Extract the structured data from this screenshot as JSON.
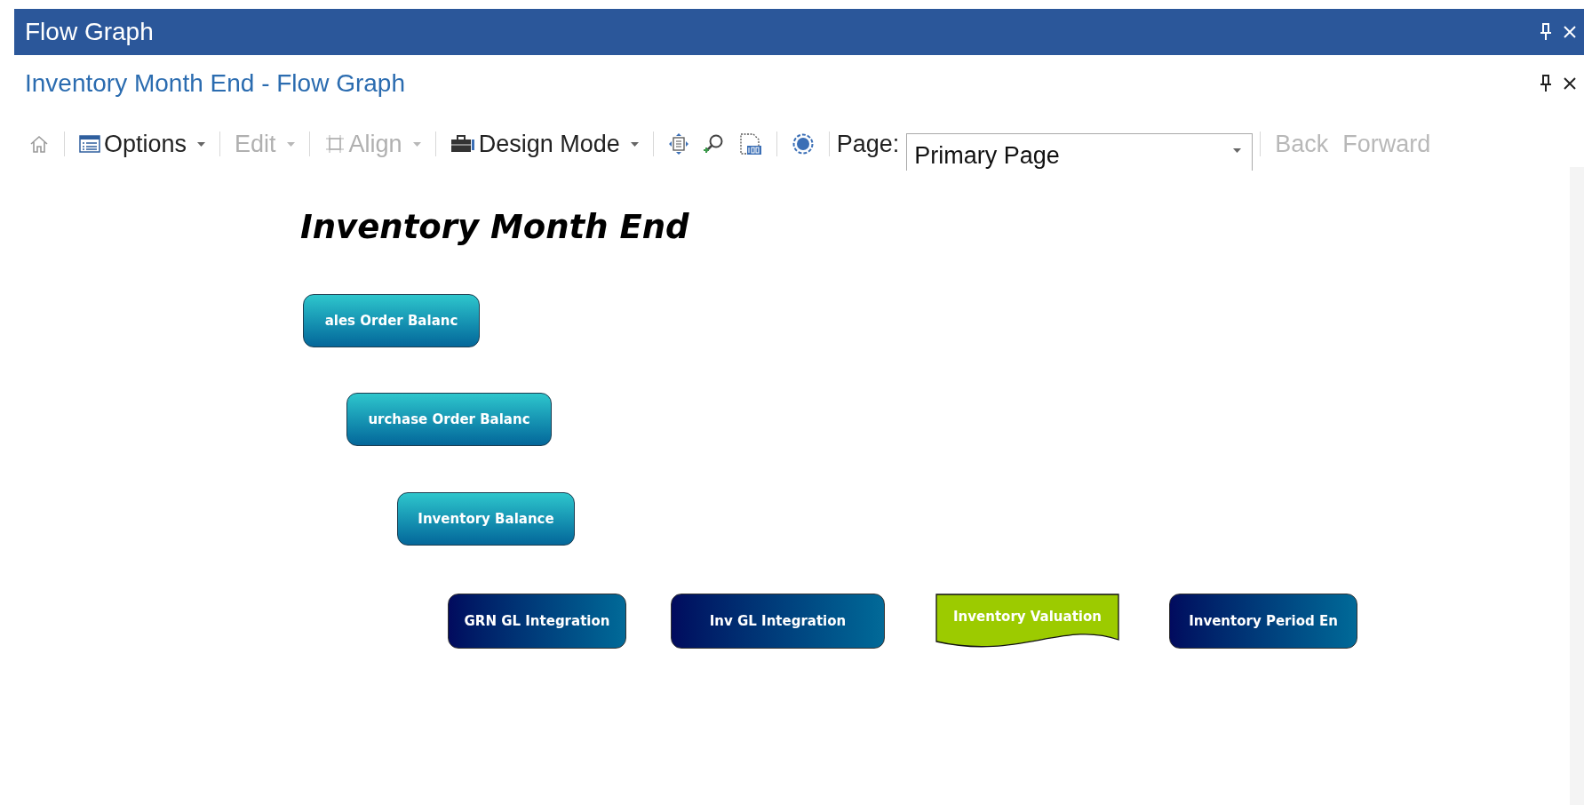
{
  "window": {
    "title": "Flow Graph"
  },
  "document": {
    "title": "Inventory Month End - Flow Graph"
  },
  "toolbar": {
    "items": [
      {
        "kind": "icon",
        "disabled": true
      },
      {
        "kind": "menu",
        "label": "Options",
        "disabled": false
      },
      {
        "kind": "menu",
        "label": "Edit",
        "disabled": true
      },
      {
        "kind": "menu",
        "label": "Align",
        "disabled": true
      },
      {
        "kind": "menu",
        "label": "Design Mode",
        "disabled": false
      },
      {
        "kind": "icon",
        "disabled": false
      },
      {
        "kind": "icon",
        "disabled": false
      },
      {
        "kind": "icon",
        "disabled": false
      },
      {
        "kind": "icon",
        "disabled": false
      }
    ],
    "page_label": "Page:",
    "page_value": "Primary Page",
    "nav": [
      {
        "label": "Back",
        "disabled": true
      },
      {
        "label": "Forward",
        "disabled": true
      }
    ]
  },
  "canvas": {
    "heading": "Inventory Month End",
    "nodes": [
      {
        "kind": "process",
        "label": "ales Order Balanc"
      },
      {
        "kind": "process",
        "label": "urchase Order Balanc"
      },
      {
        "kind": "process",
        "label": "Inventory Balance"
      },
      {
        "kind": "integration",
        "label": "GRN GL Integration"
      },
      {
        "kind": "integration",
        "label": "Inv GL Integration"
      },
      {
        "kind": "document",
        "label": "Inventory Valuation"
      },
      {
        "kind": "integration",
        "label": "Inventory Period En"
      }
    ]
  }
}
